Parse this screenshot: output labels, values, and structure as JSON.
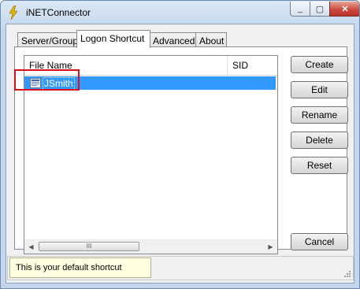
{
  "window": {
    "title": "iNETConnector",
    "min_glyph": "_",
    "max_glyph": "▢",
    "close_glyph": "✕"
  },
  "tabs": [
    {
      "label": "Server/Group"
    },
    {
      "label": "Logon Shortcut"
    },
    {
      "label": "Advanced"
    },
    {
      "label": "About"
    }
  ],
  "list": {
    "columns": [
      "File Name",
      "SID"
    ],
    "rows": [
      {
        "name": "JSmith",
        "sid": "",
        "selected": true,
        "icon": "shortcut-file-icon"
      }
    ]
  },
  "scroll": {
    "left": "◀",
    "right": "▶",
    "grip": "III"
  },
  "buttons": {
    "create": "Create",
    "edit": "Edit",
    "rename": "Rename",
    "delete": "Delete",
    "reset": "Reset",
    "cancel": "Cancel"
  },
  "tooltip": "This is your default shortcut",
  "colors": {
    "selection": "#3399ff",
    "highlight_box": "#d8111b",
    "tooltip_bg": "#ffffe1"
  }
}
